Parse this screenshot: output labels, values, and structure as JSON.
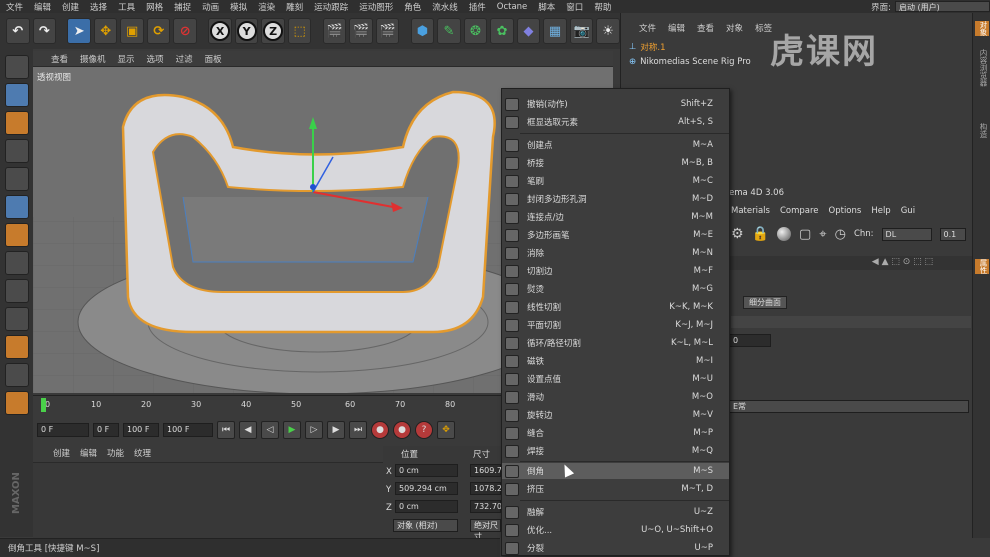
{
  "menubar": {
    "items": [
      "文件",
      "编辑",
      "创建",
      "选择",
      "工具",
      "网格",
      "捕捉",
      "动画",
      "模拟",
      "渲染",
      "雕刻",
      "运动跟踪",
      "运动图形",
      "角色",
      "流水线",
      "插件",
      "Octane",
      "脚本",
      "窗口",
      "帮助"
    ],
    "layout_label": "界面:",
    "layout_value": "启动 (用户)"
  },
  "toolbar": {
    "axis_x": "X",
    "axis_y": "Y",
    "axis_z": "Z"
  },
  "viewport": {
    "menu": [
      "查看",
      "摄像机",
      "显示",
      "选项",
      "过滤",
      "面板"
    ],
    "label": "透视视图"
  },
  "timeline": {
    "ticks": [
      "0",
      "10",
      "20",
      "30",
      "40",
      "50",
      "60",
      "70",
      "80"
    ]
  },
  "controls": {
    "start_frame": "0 F",
    "min_frame": "0 F",
    "max_frame": "100 F",
    "end_frame": "100 F"
  },
  "material_manager": {
    "menu": [
      "创建",
      "编辑",
      "功能",
      "纹理"
    ]
  },
  "coordinates": {
    "position_label": "位置",
    "size_label": "尺寸",
    "x_label": "X",
    "x_value": "0 cm",
    "x_size": "1609.7",
    "y_label": "Y",
    "y_value": "509.294 cm",
    "y_size": "1078.2",
    "z_label": "Z",
    "z_value": "0 cm",
    "z_size": "732.70",
    "mode": "对象 (相对)",
    "apply": "绝对尺寸"
  },
  "object_manager": {
    "menu": [
      "文件",
      "编辑",
      "查看",
      "对象",
      "标签"
    ],
    "objects": [
      "对称.1",
      "Nikomedias Scene Rig Pro"
    ]
  },
  "watermark": "虎课网",
  "attributes": {
    "title_partial": "ema 4D 3.06",
    "menu": [
      "Materials",
      "Compare",
      "Options",
      "Help",
      "Gui"
    ],
    "chn_label": "Chn:",
    "chn_value": "DL",
    "chn_num": "0.1",
    "subdiv_button": "细分曲面",
    "field_value": "0",
    "dropdown_partial": "E常"
  },
  "side_tabs": [
    "对象",
    "内容浏览器",
    "构造",
    "属性"
  ],
  "context_menu": {
    "items": [
      {
        "label": "撤销(动作)",
        "shortcut": "Shift+Z"
      },
      {
        "label": "框显选取元素",
        "shortcut": "Alt+S, S"
      },
      {
        "label": "创建点",
        "shortcut": "M~A"
      },
      {
        "label": "桥接",
        "shortcut": "M~B, B"
      },
      {
        "label": "笔刷",
        "shortcut": "M~C"
      },
      {
        "label": "封闭多边形孔洞",
        "shortcut": "M~D"
      },
      {
        "label": "连接点/边",
        "shortcut": "M~M"
      },
      {
        "label": "多边形画笔",
        "shortcut": "M~E"
      },
      {
        "label": "消除",
        "shortcut": "M~N"
      },
      {
        "label": "切割边",
        "shortcut": "M~F"
      },
      {
        "label": "熨烫",
        "shortcut": "M~G"
      },
      {
        "label": "线性切割",
        "shortcut": "K~K, M~K"
      },
      {
        "label": "平面切割",
        "shortcut": "K~J, M~J"
      },
      {
        "label": "循环/路径切割",
        "shortcut": "K~L, M~L"
      },
      {
        "label": "磁铁",
        "shortcut": "M~I"
      },
      {
        "label": "设置点值",
        "shortcut": "M~U"
      },
      {
        "label": "滑动",
        "shortcut": "M~O"
      },
      {
        "label": "旋转边",
        "shortcut": "M~V"
      },
      {
        "label": "缝合",
        "shortcut": "M~P"
      },
      {
        "label": "焊接",
        "shortcut": "M~Q"
      },
      {
        "label": "倒角",
        "shortcut": "M~S"
      },
      {
        "label": "挤压",
        "shortcut": "M~T, D"
      },
      {
        "label": "融解",
        "shortcut": "U~Z"
      },
      {
        "label": "优化...",
        "shortcut": "U~O, U~Shift+O"
      },
      {
        "label": "分裂",
        "shortcut": "U~P"
      }
    ],
    "highlighted_index": 20
  },
  "statusbar": {
    "text": "倒角工具 [快捷键 M~S]"
  }
}
